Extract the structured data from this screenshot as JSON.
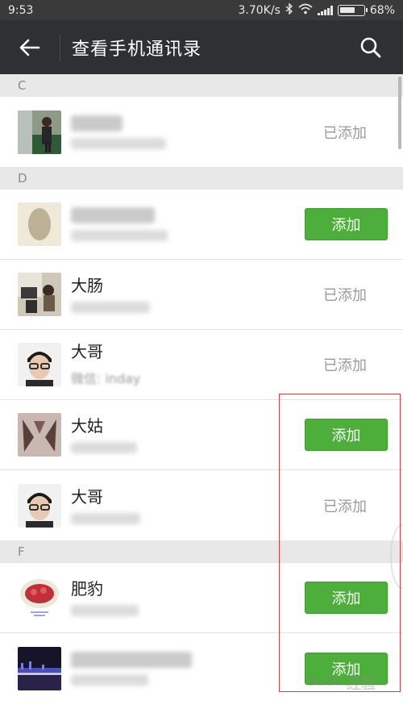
{
  "status_bar": {
    "time": "9:53",
    "network_speed": "3.70K/s",
    "battery_percent": "68%",
    "battery_level": 0.68,
    "icons": [
      "bluetooth-icon",
      "wifi-icon",
      "signal-icon",
      "battery-icon"
    ]
  },
  "header": {
    "title": "查看手机通讯录",
    "back_icon": "arrow-left-icon",
    "search_icon": "search-icon"
  },
  "sections": [
    {
      "letter": "C",
      "contacts": [
        {
          "name": "",
          "status": "added",
          "status_label": "已添加"
        }
      ]
    },
    {
      "letter": "D",
      "contacts": [
        {
          "name": "",
          "status": "add",
          "status_label": "添加"
        },
        {
          "name": "大肠",
          "status": "added",
          "status_label": "已添加"
        },
        {
          "name": "大哥",
          "subtitle": "微信: inday",
          "status": "added",
          "status_label": "已添加"
        },
        {
          "name": "大姑",
          "status": "add",
          "status_label": "添加"
        },
        {
          "name": "大哥",
          "status": "added",
          "status_label": "已添加"
        }
      ]
    },
    {
      "letter": "F",
      "contacts": [
        {
          "name": "肥豹",
          "status": "add",
          "status_label": "添加"
        },
        {
          "name": "",
          "status": "add",
          "status_label": "添加"
        }
      ]
    }
  ],
  "watermark": {
    "text": "经验",
    "logo": "Baidu"
  },
  "colors": {
    "action_bar": "#2f3034",
    "status_bar": "#3a3a3a",
    "add_button": "#4eae3c",
    "section_header": "#e8e8e8",
    "highlight_box": "#c0444a"
  }
}
